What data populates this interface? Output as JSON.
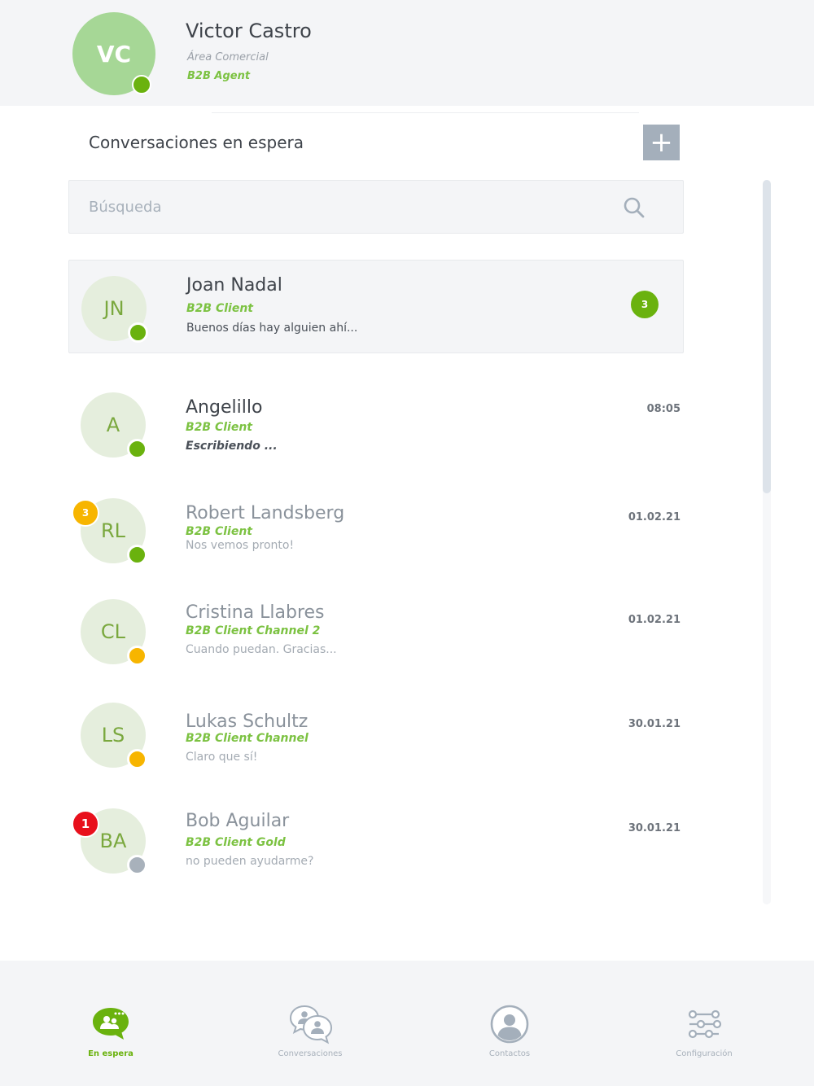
{
  "colors": {
    "brand_green": "#7cc242",
    "online": "#6ab20e",
    "away": "#f7b500",
    "offline": "#a8b1bb",
    "alert_red": "#e8101c",
    "add_button": "#a4afbb"
  },
  "profile": {
    "initials": "VC",
    "name": "Victor Castro",
    "department": "Área Comercial",
    "role": "B2B Agent",
    "status": "online"
  },
  "section": {
    "title": "Conversaciones en espera",
    "add_label": "+"
  },
  "search": {
    "placeholder": "Búsqueda",
    "value": "",
    "icon": "search-icon"
  },
  "conversations": [
    {
      "initials": "JN",
      "name": "Joan Nadal",
      "channel": "B2B Client",
      "preview": "Buenos días hay alguien ahí...",
      "time": "",
      "unread": "3",
      "status": "online",
      "active": true
    },
    {
      "initials": "A",
      "name": "Angelillo",
      "channel": "B2B Client",
      "preview": "Escribiendo ...",
      "time": "08:05",
      "status": "online",
      "typing": true
    },
    {
      "initials": "RL",
      "name": "Robert Landsberg",
      "channel": "B2B Client",
      "preview": "Nos vemos pronto!",
      "time": "01.02.21",
      "badge": "3",
      "badge_color": "away",
      "status": "online"
    },
    {
      "initials": "CL",
      "name": "Cristina Llabres",
      "channel": "B2B Client Channel 2",
      "preview": "Cuando puedan. Gracias...",
      "time": "01.02.21",
      "status": "away"
    },
    {
      "initials": "LS",
      "name": "Lukas Schultz",
      "channel": "B2B Client Channel",
      "preview": "Claro que sí!",
      "time": "30.01.21",
      "status": "away"
    },
    {
      "initials": "BA",
      "name": "Bob Aguilar",
      "channel": "B2B Client Gold",
      "preview": "no pueden ayudarme?",
      "time": "30.01.21",
      "badge": "1",
      "badge_color": "alert_red",
      "status": "offline"
    }
  ],
  "nav": {
    "items": [
      {
        "label": "En espera",
        "icon": "waiting-chat-icon",
        "active": true
      },
      {
        "label": "Conversaciones",
        "icon": "conversations-icon",
        "active": false
      },
      {
        "label": "Contactos",
        "icon": "contacts-icon",
        "active": false
      },
      {
        "label": "Configuración",
        "icon": "settings-sliders-icon",
        "active": false
      }
    ]
  }
}
